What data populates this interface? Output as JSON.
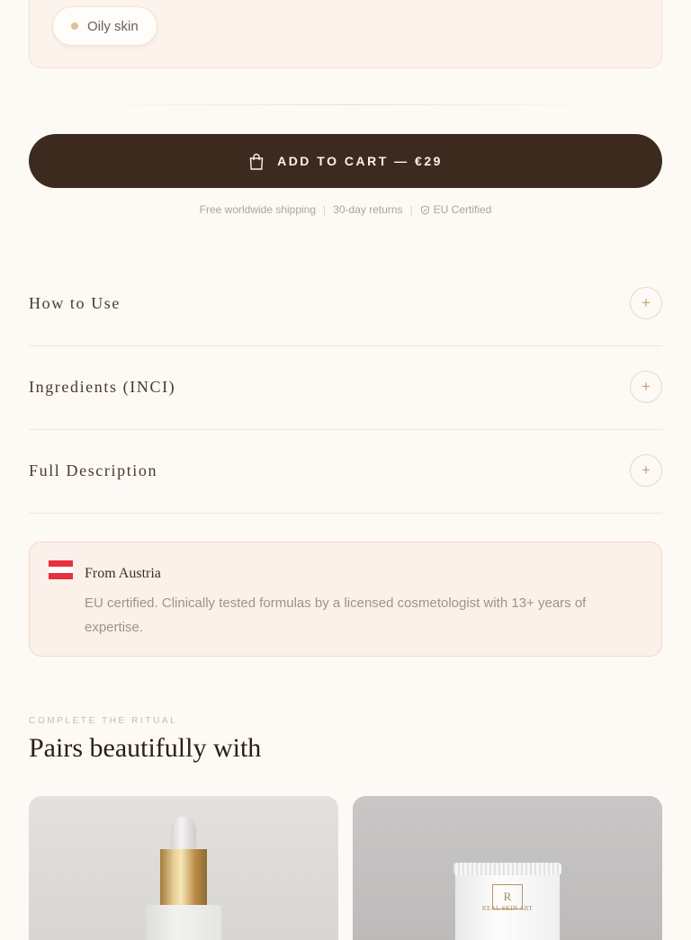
{
  "skin_types": {
    "selected": "Oily skin"
  },
  "cart": {
    "label": "ADD TO CART — €29"
  },
  "perks": {
    "shipping": "Free worldwide shipping",
    "returns": "30-day returns",
    "certified": "EU Certified"
  },
  "accordion": [
    {
      "label": "How to Use"
    },
    {
      "label": "Ingredients (INCI)"
    },
    {
      "label": "Full Description"
    }
  ],
  "accordion_icon": "+",
  "origin": {
    "title": "From Austria",
    "text": "EU certified. Clinically tested formulas by a licensed cosmetologist with 13+ years of expertise.",
    "flag_colors": [
      "#e8313c",
      "#ffffff",
      "#e8313c"
    ]
  },
  "pairs": {
    "eyebrow": "COMPLETE THE RITUAL",
    "title": "Pairs beautifully with",
    "products": [
      {
        "image": "dropper-bottle"
      },
      {
        "image": "cream-tube",
        "logo_text": "REAL SKIN ART",
        "logo_monogram": "R"
      }
    ]
  },
  "colors": {
    "background": "#fdf9f4",
    "cart_button": "#3d2a1f",
    "accent_gold": "#c4a070"
  }
}
